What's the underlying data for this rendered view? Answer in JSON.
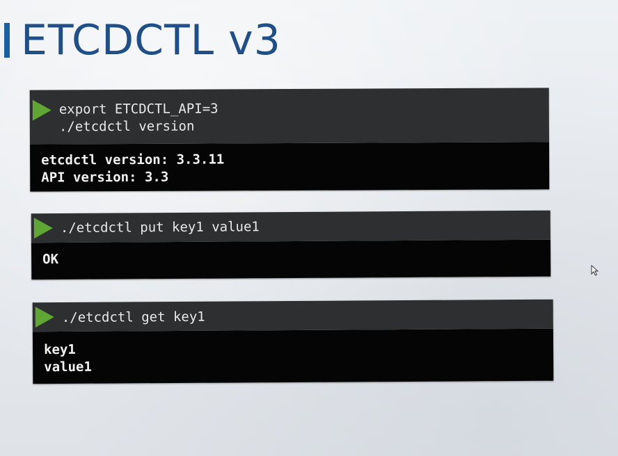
{
  "slide": {
    "title": "ETCDCTL v3",
    "accent_color": "#1a5fa0",
    "title_color": "#1f4f86"
  },
  "terminals": [
    {
      "commands": [
        "export ETCDCTL_API=3",
        "./etcdctl version"
      ],
      "output": [
        "etcdctl version: 3.3.11",
        "API version: 3.3"
      ]
    },
    {
      "commands": [
        "./etcdctl put key1 value1"
      ],
      "output": [
        "OK"
      ]
    },
    {
      "commands": [
        "./etcdctl get key1"
      ],
      "output": [
        "key1",
        "value1"
      ]
    }
  ],
  "icons": {
    "run": "play-icon",
    "pointer": "mouse-cursor-icon"
  },
  "colors": {
    "command_bg": "#2d2f31",
    "output_bg": "#050505",
    "play_green": "#5fa634"
  }
}
